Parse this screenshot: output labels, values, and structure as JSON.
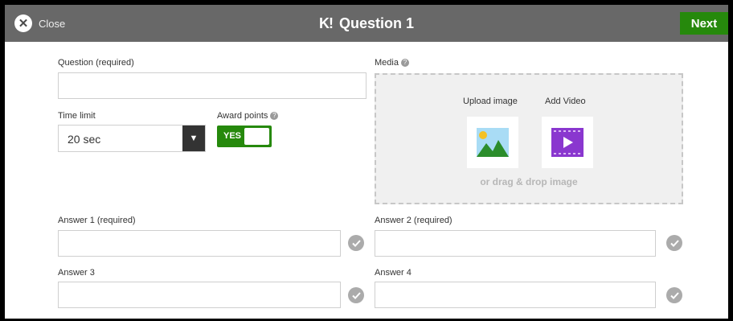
{
  "header": {
    "close_label": "Close",
    "logo": "K!",
    "title": "Question 1",
    "next_label": "Next"
  },
  "question": {
    "label": "Question (required)",
    "value": ""
  },
  "time_limit": {
    "label": "Time limit",
    "value": "20 sec"
  },
  "award_points": {
    "label": "Award points",
    "toggle_label": "YES",
    "enabled": true
  },
  "media": {
    "label": "Media",
    "upload_image_label": "Upload image",
    "add_video_label": "Add Video",
    "drag_drop_text": "or drag & drop image"
  },
  "answers": [
    {
      "label": "Answer 1 (required)",
      "value": ""
    },
    {
      "label": "Answer 2 (required)",
      "value": ""
    },
    {
      "label": "Answer 3",
      "value": ""
    },
    {
      "label": "Answer 4",
      "value": ""
    }
  ],
  "colors": {
    "header_bg": "#686868",
    "accent_green": "#26890c",
    "video_purple": "#8a37cf",
    "check_gray": "#ababab"
  },
  "icons": [
    "close-icon",
    "info-icon",
    "image-icon",
    "video-icon",
    "check-icon",
    "dropdown-arrow-icon"
  ]
}
